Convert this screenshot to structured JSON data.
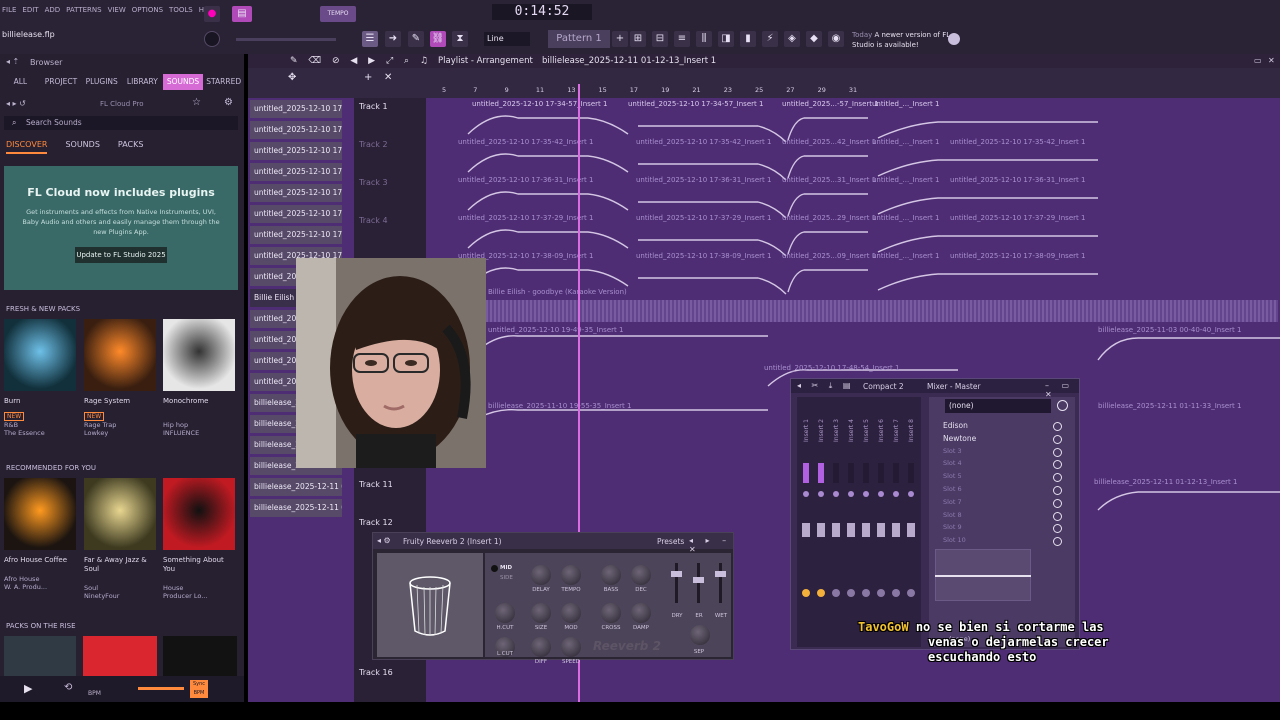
{
  "app": {
    "project_file": "billielease.flp",
    "time_display": "0:14:52",
    "menu": [
      "FILE",
      "EDIT",
      "ADD",
      "PATTERNS",
      "VIEW",
      "OPTIONS",
      "TOOLS",
      "HELP"
    ],
    "snap_mode": "Line",
    "pattern_name": "Pattern 1",
    "update_notice": {
      "prefix": "Today",
      "message": "A newer version of FL Studio is available!"
    }
  },
  "browser": {
    "title": "Browser",
    "tabs": [
      "ALL",
      "PROJECT",
      "PLUGINS",
      "LIBRARY",
      "SOUNDS",
      "STARRED"
    ],
    "active_tab": "SOUNDS",
    "cloud_label": "FL Cloud Pro",
    "search_placeholder": "Search Sounds",
    "sub_tabs": [
      "DISCOVER",
      "SOUNDS",
      "PACKS"
    ],
    "promo": {
      "title": "FL Cloud now includes plugins",
      "body": "Get instruments and effects from Native Instruments, UVI, Baby Audio and others and easily manage them through the new Plugins App.",
      "button": "Update to FL Studio 2025"
    },
    "fresh_heading": "FRESH & NEW PACKS",
    "fresh_packs": [
      {
        "name": "Burn",
        "badge": "NEW",
        "genre": "R&B",
        "author": "The Essence"
      },
      {
        "name": "Rage System",
        "badge": "NEW",
        "genre": "Rage Trap",
        "author": "Lowkey"
      },
      {
        "name": "Monochrome",
        "badge": "",
        "genre": "Hip hop",
        "author": "INFLUENCE"
      }
    ],
    "recommended_heading": "RECOMMENDED FOR YOU",
    "recommended_packs": [
      {
        "name": "Afro House Coffee",
        "genre": "Afro House",
        "author": "W. A. Produ..."
      },
      {
        "name": "Far & Away Jazz & Soul",
        "genre": "Soul",
        "author": "NinetyFour"
      },
      {
        "name": "Something About You",
        "genre": "House",
        "author": "Producer Lo..."
      }
    ],
    "rise_heading": "PACKS ON THE RISE",
    "transport": {
      "bpm_label": "BPM",
      "sync_label": "Sync BPM"
    }
  },
  "playlist": {
    "title": "Playlist - Arrangement",
    "current_pattern": "billielease_2025-12-11 01-12-13_Insert 1",
    "ruler": [
      "5",
      "7",
      "9",
      "11",
      "13",
      "15",
      "17",
      "19",
      "21",
      "23",
      "25",
      "27",
      "29",
      "31"
    ],
    "patterns": [
      "untitled_2025-12-10 17-...",
      "untitled_2025-12-10 17-...",
      "untitled_2025-12-10 17-...",
      "untitled_2025-12-10 17-...",
      "untitled_2025-12-10 17-...",
      "untitled_2025-12-10 17-...",
      "untitled_2025-12-10 17-...",
      "untitled_2025-12-10 17-...",
      "untitled_2025-12-10 17-...",
      "Billie Eilish - ...",
      "untitled_202...",
      "untitled_202...",
      "untitled_202...",
      "untitled_202...",
      "billielease_2...",
      "billielease_2...",
      "billielease_2...",
      "billielease_2...",
      "billielease_2025-12-11 0...",
      "billielease_2025-12-11 0..."
    ],
    "tracks": [
      {
        "name": "Track 1",
        "dim": false
      },
      {
        "name": "Track 2",
        "dim": true
      },
      {
        "name": "Track 3",
        "dim": true
      },
      {
        "name": "Track 4",
        "dim": true
      },
      {
        "name": "Track 11",
        "dim": false
      },
      {
        "name": "Track 12",
        "dim": false
      },
      {
        "name": "Track 16",
        "dim": false
      }
    ],
    "clips": {
      "row1": [
        "untitled_2025-12-10 17-34-57_Insert 1",
        "untitled_2025-12-10 17-34-57_Insert 1",
        "untitled_2025...-57_Insert 1",
        "untitled_..._Insert 1"
      ],
      "row2": [
        "untitled_2025-12-10 17-35-42_Insert 1",
        "untitled_2025-12-10 17-35-42_Insert 1",
        "untitled_2025...42_Insert 1",
        "untitled_..._Insert 1",
        "untitled_2025-12-10 17-35-42_Insert 1"
      ],
      "row3": [
        "untitled_2025-12-10 17-36-31_Insert 1",
        "untitled_2025-12-10 17-36-31_Insert 1",
        "untitled_2025...31_Insert 1",
        "untitled_..._Insert 1",
        "untitled_2025-12-10 17-36-31_Insert 1"
      ],
      "row4": [
        "untitled_2025-12-10 17-37-29_Insert 1",
        "untitled_2025-12-10 17-37-29_Insert 1",
        "untitled_2025...29_Insert 1",
        "untitled_..._Insert 1",
        "untitled_2025-12-10 17-37-29_Insert 1"
      ],
      "row5": [
        "untitled_2025-12-10 17-38-09_Insert 1",
        "untitled_2025-12-10 17-38-09_Insert 1",
        "untitled_2025...09_Insert 1",
        "untitled_..._Insert 1",
        "untitled_2025-12-10 17-38-09_Insert 1"
      ],
      "audio": "Billie Eilish - goodbye (Karaoke Version)",
      "row7a": "untitled_2025-12-10 19-49-35_Insert 1",
      "row7b": "billielease_2025-11-03 00-40-40_Insert 1",
      "row8": "untitled_2025-12-10 17-48-54_Insert 1",
      "row9a": "billielease_2025-11-10 19-55-35_Insert 1",
      "row9b": "billielease_2025-12-11 01-11-33_Insert 1",
      "row10": "billielease_2025-12-11 01-12-13_Insert 1"
    }
  },
  "mixer": {
    "compact_label": "Compact 2",
    "title": "Mixer - Master",
    "preset": "(none)",
    "inserts": [
      "Insert 1",
      "Insert 2",
      "Insert 3",
      "Insert 4",
      "Insert 5",
      "Insert 6",
      "Insert 7",
      "Insert 8"
    ],
    "slots": [
      {
        "name": "Edison",
        "empty": false
      },
      {
        "name": "Newtone",
        "empty": false
      },
      {
        "name": "Slot 3",
        "empty": true
      },
      {
        "name": "Slot 4",
        "empty": true
      },
      {
        "name": "Slot 5",
        "empty": true
      },
      {
        "name": "Slot 6",
        "empty": true
      },
      {
        "name": "Slot 7",
        "empty": true
      },
      {
        "name": "Slot 8",
        "empty": true
      },
      {
        "name": "Slot 9",
        "empty": true
      },
      {
        "name": "Slot 10",
        "empty": true
      }
    ],
    "output": "(none)"
  },
  "reverb": {
    "title": "Fruity Reeverb 2 (Insert 1)",
    "presets_label": "Presets",
    "mode_mid": "MID",
    "mode_side": "SIDE",
    "knobs": [
      "DELAY",
      "TEMPO",
      "BASS",
      "DEC",
      "SIZE",
      "MOD",
      "CROSS",
      "DAMP",
      "DIFF",
      "SPEED"
    ],
    "cut_labels": [
      "H.CUT",
      "L.CUT"
    ],
    "mix_labels": [
      "DRY",
      "ER",
      "WET"
    ],
    "sep_label": "SEP",
    "logo": "Reeverb 2"
  },
  "chat": {
    "user": "TavoGoW",
    "line1": "no se bien si cortarme las",
    "line2": "venas o dejarmelas crecer",
    "line3": "escuchando esto"
  }
}
